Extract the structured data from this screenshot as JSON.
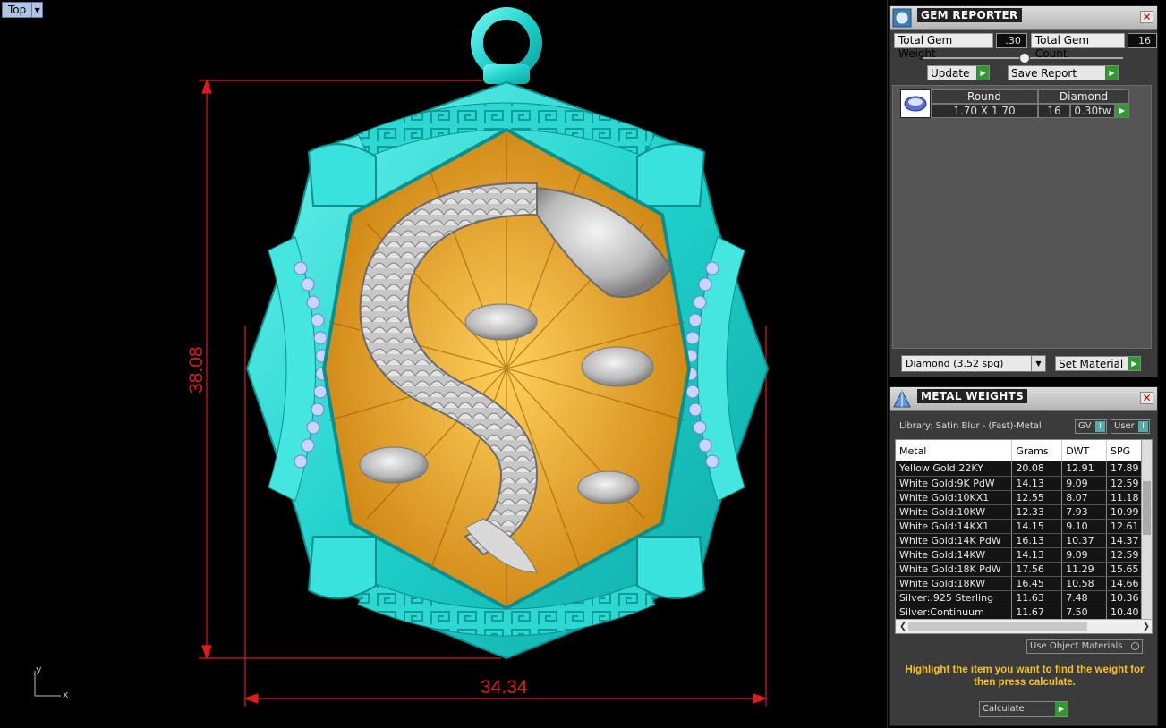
{
  "viewport": {
    "view_name": "Top",
    "dim_width": "34.34",
    "dim_height": "38.08",
    "axis_x": "x",
    "axis_y": "y",
    "colors": {
      "metal": "#25dcd6",
      "gold": "#f1a626",
      "silver": "#c9c9c9",
      "dimension": "#e01a1a",
      "gem": "#c8d6ff"
    }
  },
  "gem_reporter": {
    "title": "GEM REPORTER",
    "total_weight_label": "Total Gem Weight",
    "total_weight_value": ".30",
    "total_count_label": "Total Gem Count",
    "total_count_value": "16",
    "update_label": "Update",
    "save_report_label": "Save Report",
    "gem": {
      "shape": "Round",
      "material": "Diamond",
      "size": "1.70 X 1.70",
      "count": "16",
      "weight": "0.30tw"
    },
    "material_select": "Diamond    (3.52 spg)",
    "set_material_label": "Set Material"
  },
  "metal_weights": {
    "title": "METAL WEIGHTS",
    "library": "Library: Satin Blur - (Fast)-Metal",
    "gv_label": "GV",
    "user_label": "User",
    "columns": [
      "Metal",
      "Grams",
      "DWT",
      "SPG"
    ],
    "rows": [
      [
        "Yellow Gold:22KY",
        "20.08",
        "12.91",
        "17.89"
      ],
      [
        "White Gold:9K PdW",
        "14.13",
        "9.09",
        "12.59"
      ],
      [
        "White Gold:10KX1",
        "12.55",
        "8.07",
        "11.18"
      ],
      [
        "White Gold:10KW",
        "12.33",
        "7.93",
        "10.99"
      ],
      [
        "White Gold:14KX1",
        "14.15",
        "9.10",
        "12.61"
      ],
      [
        "White Gold:14K PdW",
        "16.13",
        "10.37",
        "14.37"
      ],
      [
        "White Gold:14KW",
        "14.13",
        "9.09",
        "12.59"
      ],
      [
        "White Gold:18K PdW",
        "17.56",
        "11.29",
        "15.65"
      ],
      [
        "White Gold:18KW",
        "16.45",
        "10.58",
        "14.66"
      ],
      [
        "Silver:.925 Sterling",
        "11.63",
        "7.48",
        "10.36"
      ],
      [
        "Silver:Continuum",
        "11.67",
        "7.50",
        "10.40"
      ]
    ],
    "use_object_materials": "Use Object Materials",
    "hint": "Highlight the item you want to find the weight for then press calculate.",
    "calculate_label": "Calculate"
  }
}
